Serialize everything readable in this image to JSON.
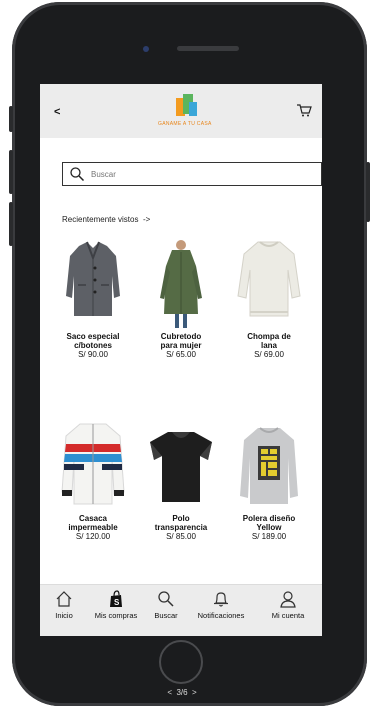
{
  "header": {
    "back_label": "<",
    "logo_text": "GANAME A TU CASA"
  },
  "search": {
    "placeholder": "Buscar"
  },
  "recent": {
    "label": "Recientemente vistos",
    "arrow": "->"
  },
  "products": [
    {
      "name_line1": "Saco especial",
      "name_line2": "c/botones",
      "price": "S/ 90.00",
      "icon": "gray-coat-image"
    },
    {
      "name_line1": "Cubretodo",
      "name_line2": "para mujer",
      "price": "S/ 65.00",
      "icon": "green-trench-coat-image"
    },
    {
      "name_line1": "Chompa de",
      "name_line2": "lana",
      "price": "S/ 69.00",
      "icon": "cream-sweater-image"
    },
    {
      "name_line1": "Casaca",
      "name_line2": "impermeable",
      "price": "S/ 120.00",
      "icon": "striped-jacket-image"
    },
    {
      "name_line1": "Polo",
      "name_line2": "transparencia",
      "price": "S/ 85.00",
      "icon": "black-blouse-image"
    },
    {
      "name_line1": "Polera diseño",
      "name_line2": "Yellow",
      "price": "S/ 189.00",
      "icon": "gray-sweatshirt-image"
    }
  ],
  "nav": {
    "home": "Inicio",
    "purchases": "Mis compras",
    "search": "Buscar",
    "notifications": "Notificaciones",
    "account": "Mi cuenta"
  },
  "pager": {
    "text": "3/6",
    "prev": "<",
    "next": ">"
  }
}
